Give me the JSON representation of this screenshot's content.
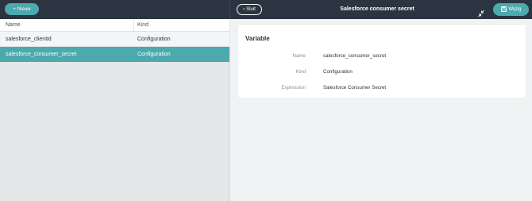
{
  "toolbar": {
    "new_label": "Nieuw",
    "close_label": "Sluit",
    "title": "Salesforce consumer secret",
    "edit_label": "Wijzig"
  },
  "table": {
    "columns": [
      "Name",
      "Kind"
    ],
    "rows": [
      {
        "name": "salesforce_clientid",
        "kind": "Configuration",
        "selected": false
      },
      {
        "name": "salesforce_consumer_secret",
        "kind": "Configuration",
        "selected": true
      }
    ]
  },
  "detail": {
    "heading": "Variable",
    "fields": [
      {
        "label": "Name",
        "value": "salesforce_consumer_secret"
      },
      {
        "label": "Kind",
        "value": "Configuration"
      },
      {
        "label": "Expression",
        "value": "Salesforce Consumer Secret"
      }
    ]
  },
  "colors": {
    "accent": "#4ca9ae",
    "topbar": "#2b3441"
  },
  "icons": [
    "plus-icon",
    "chevron-left-icon",
    "collapse-icon",
    "save-icon"
  ]
}
